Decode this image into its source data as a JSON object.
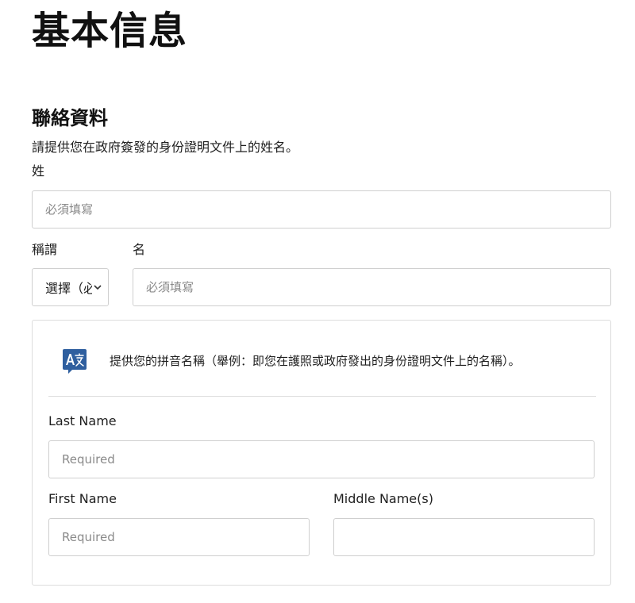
{
  "page": {
    "title": "基本信息"
  },
  "contact_section": {
    "title": "聯絡資料",
    "description": "請提供您在政府簽發的身份證明文件上的姓名。",
    "surname": {
      "label": "姓",
      "placeholder": "必須填寫"
    },
    "salutation": {
      "label": "稱謂",
      "value": "選擇（必"
    },
    "given_name": {
      "label": "名",
      "placeholder": "必須填寫"
    }
  },
  "pinyin_section": {
    "icon": "translate-icon",
    "note": "提供您的拼音名稱（舉例：即您在護照或政府發出的身份證明文件上的名稱）。",
    "last_name": {
      "label": "Last Name",
      "placeholder": "Required"
    },
    "first_name": {
      "label": "First Name",
      "placeholder": "Required"
    },
    "middle_name": {
      "label": "Middle Name(s)",
      "placeholder": ""
    }
  },
  "colors": {
    "border": "#cfcfcf",
    "icon_blue": "#2f5f9f",
    "text": "#1f1f1f",
    "placeholder": "#8a8a8a"
  }
}
